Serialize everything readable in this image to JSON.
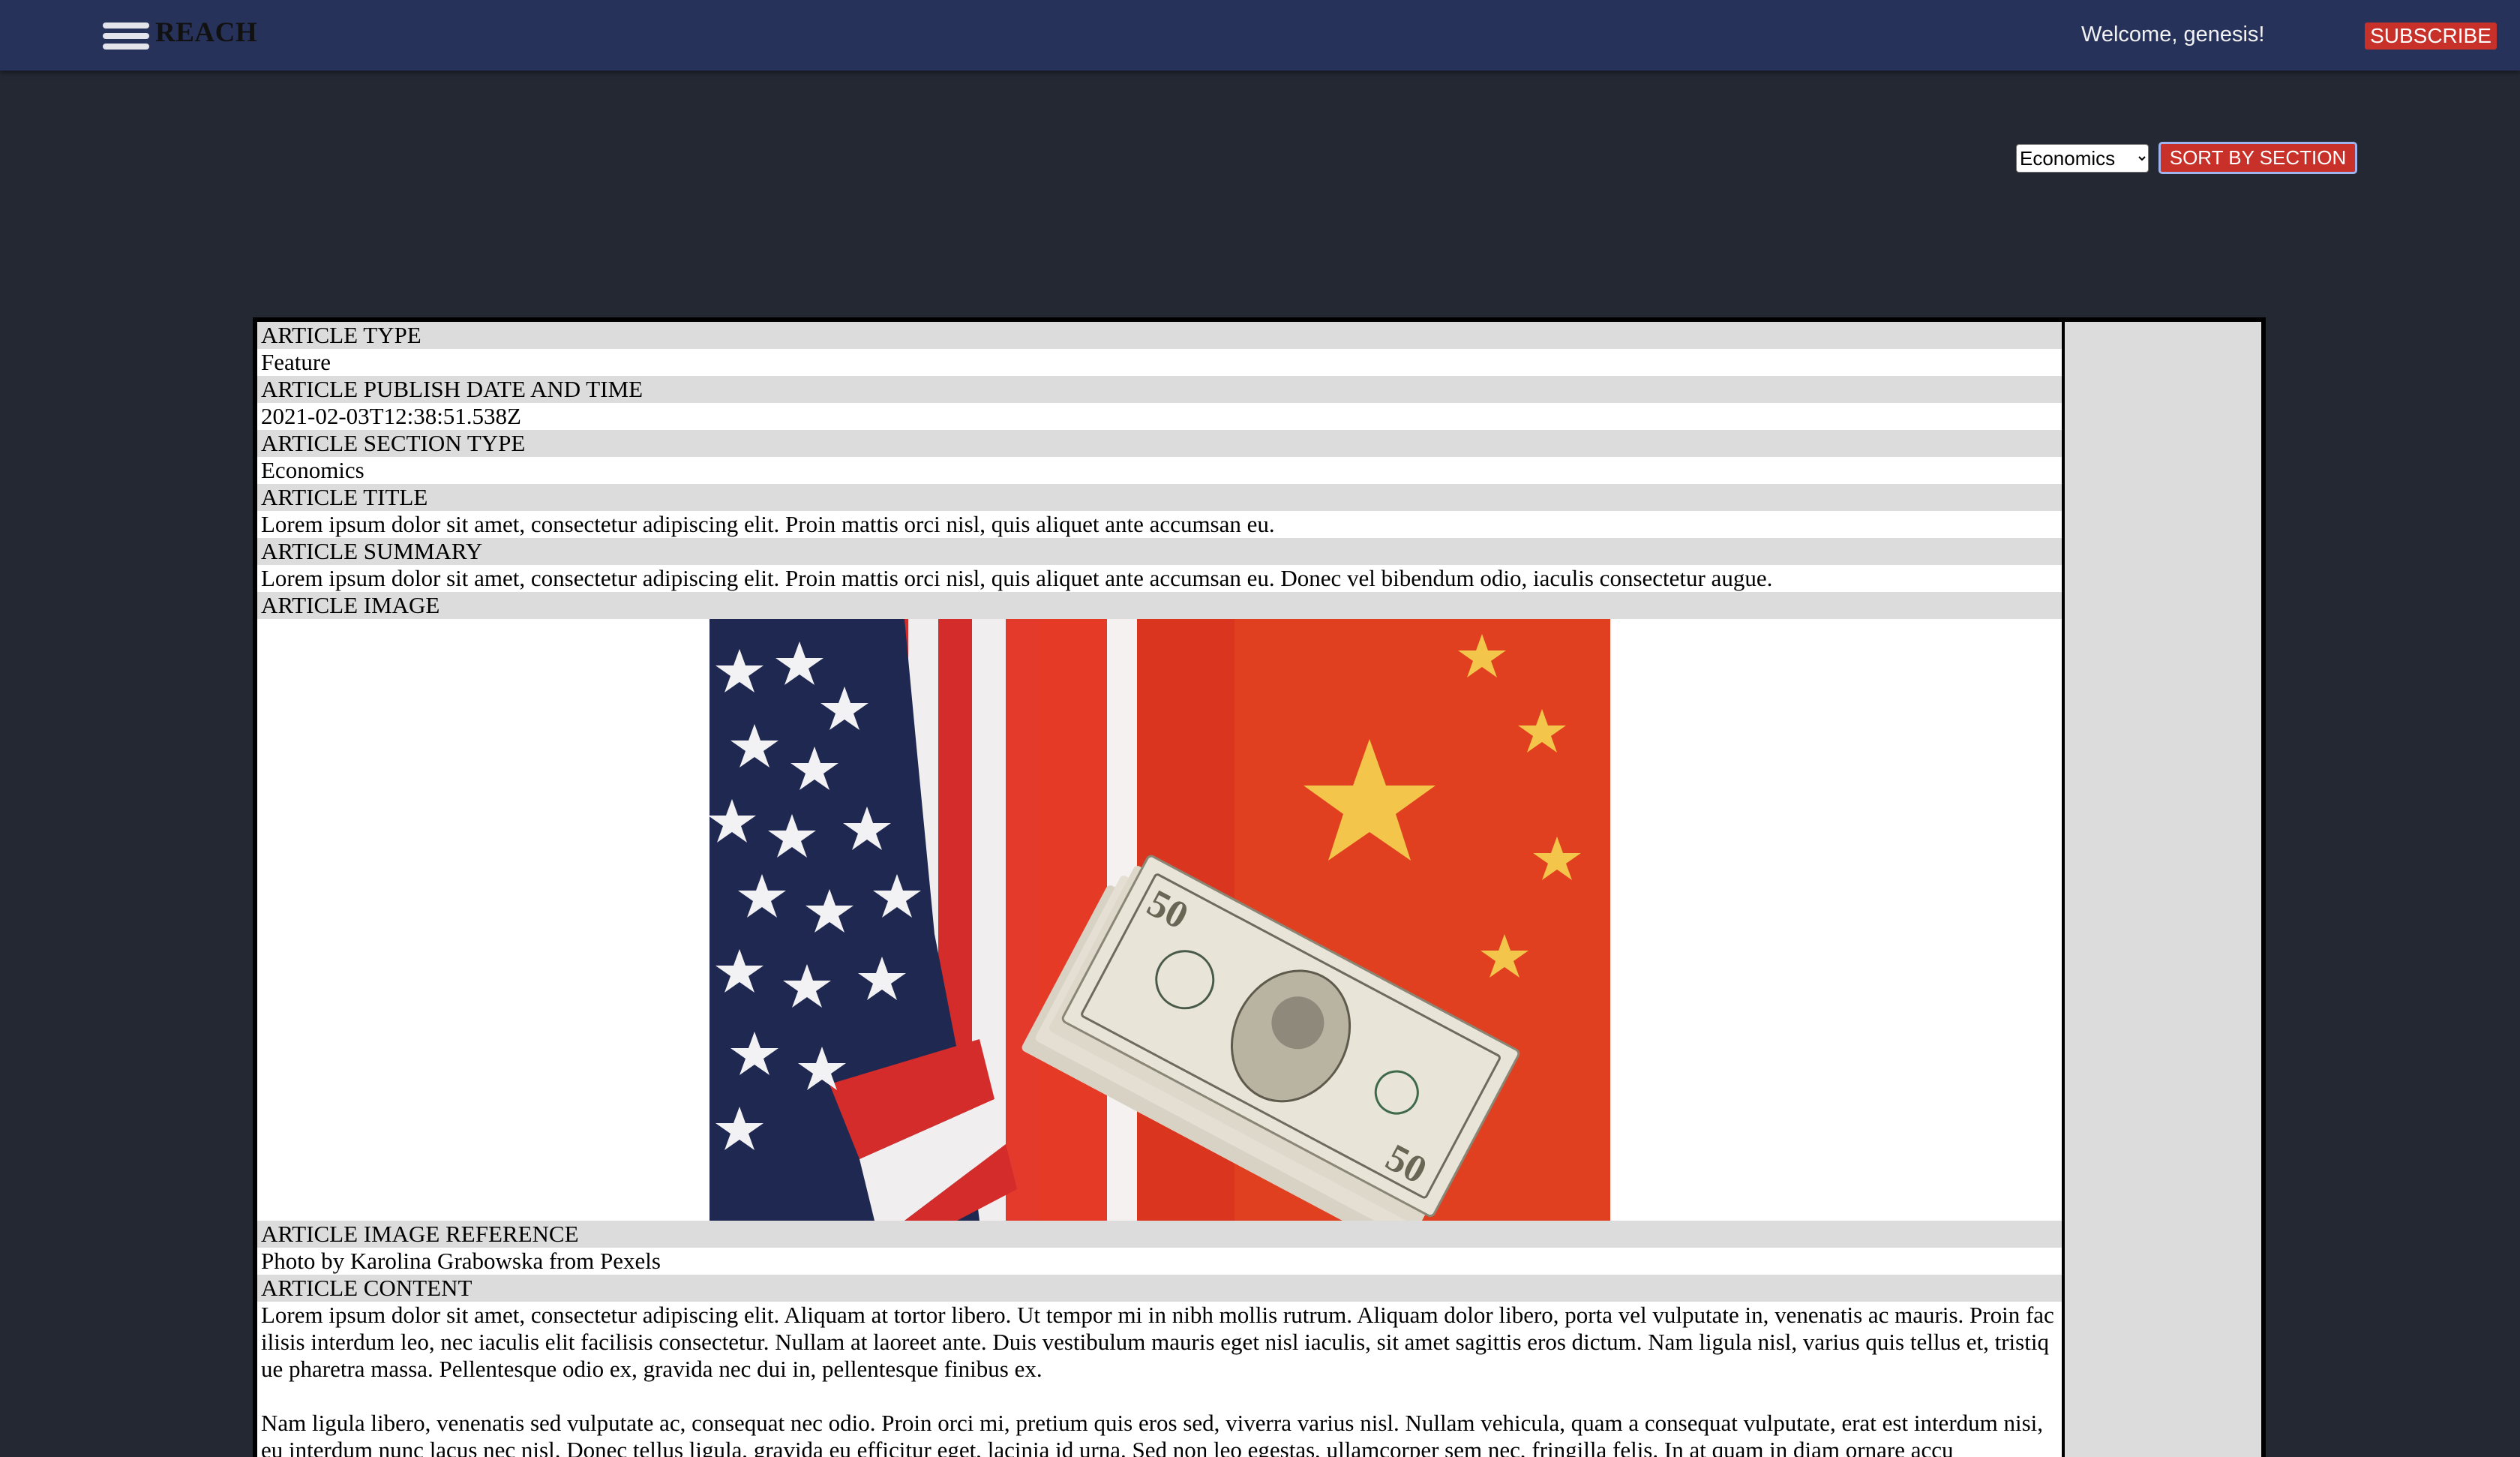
{
  "header": {
    "brand": "REACH",
    "welcome": "Welcome, genesis!",
    "subscribe_label": "SUBSCRIBE",
    "menu_icon": "hamburger-menu-icon"
  },
  "controls": {
    "section_selected": "Economics",
    "sort_label": "SORT BY SECTION"
  },
  "article": {
    "type_label": "ARTICLE TYPE",
    "type_value": "Feature",
    "date_label": "ARTICLE PUBLISH DATE AND TIME",
    "date_value": "2021-02-03T12:38:51.538Z",
    "section_label": "ARTICLE SECTION TYPE",
    "section_value": "Economics",
    "title_label": "ARTICLE TITLE",
    "title_value": "Lorem ipsum dolor sit amet, consectetur adipiscing elit. Proin mattis orci nisl, quis aliquet ante accumsan eu.",
    "summary_label": "ARTICLE SUMMARY",
    "summary_value": "Lorem ipsum dolor sit amet, consectetur adipiscing elit. Proin mattis orci nisl, quis aliquet ante accumsan eu. Donec vel bibendum odio, iaculis consectetur augue.",
    "image_label": "ARTICLE IMAGE",
    "image_reference_label": "ARTICLE IMAGE REFERENCE",
    "image_reference_value": "Photo by Karolina Grabowska from Pexels",
    "content_label": "ARTICLE CONTENT",
    "content_paragraphs": [
      "Lorem ipsum dolor sit amet, consectetur adipiscing elit. Aliquam at tortor libero. Ut tempor mi in nibh mollis rutrum. Aliquam dolor libero, porta vel vulputate in, venenatis ac mauris. Proin facilisis interdum leo, nec iaculis elit facilisis consectetur. Nullam at laoreet ante. Duis vestibulum mauris eget nisl iaculis, sit amet sagittis eros dictum. Nam ligula nisl, varius quis tellus et, tristique pharetra massa. Pellentesque odio ex, gravida nec dui in, pellentesque finibus ex.",
      "Nam ligula libero, venenatis sed vulputate ac, consequat nec odio. Proin orci mi, pretium quis eros sed, viverra varius nisl. Nullam vehicula, quam a consequat vulputate, erat est interdum nisi, eu interdum nunc lacus nec nisl. Donec tellus ligula, gravida eu efficitur eget, lacinia id urna. Sed non leo egestas, ullamcorper sem nec, fringilla felis. In at quam in diam ornare accu"
    ]
  }
}
